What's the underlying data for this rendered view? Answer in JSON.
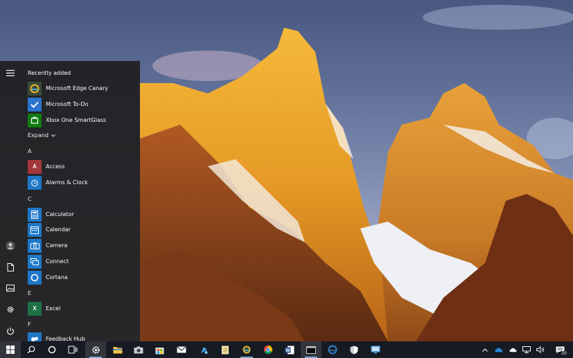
{
  "start_menu": {
    "recently_added_label": "Recently added",
    "expand_label": "Expand",
    "recent": [
      {
        "label": "Microsoft Edge Canary",
        "icon": "edge-canary-icon",
        "color": "#3a4a38"
      },
      {
        "label": "Microsoft To-Do",
        "icon": "todo-icon",
        "color": "#2a73cf"
      },
      {
        "label": "Xbox One SmartGlass",
        "icon": "xbox-icon",
        "color": "#107c10"
      }
    ],
    "letters": {
      "a": "A",
      "c": "C",
      "e": "E",
      "f": "F"
    },
    "apps_a": [
      {
        "label": "Access",
        "icon": "access-icon",
        "color": "#a4373a"
      },
      {
        "label": "Alarms & Clock",
        "icon": "alarm-clock-icon",
        "color": "#1e78c8"
      }
    ],
    "apps_c": [
      {
        "label": "Calculator",
        "icon": "calculator-icon",
        "color": "#1e78c8"
      },
      {
        "label": "Calendar",
        "icon": "calendar-icon",
        "color": "#1e78c8"
      },
      {
        "label": "Camera",
        "icon": "camera-icon",
        "color": "#1e78c8"
      },
      {
        "label": "Connect",
        "icon": "connect-icon",
        "color": "#1e78c8"
      },
      {
        "label": "Cortana",
        "icon": "cortana-icon",
        "color": "#1e78c8"
      }
    ],
    "apps_e": [
      {
        "label": "Excel",
        "icon": "excel-icon",
        "color": "#1e7145"
      }
    ],
    "apps_f": [
      {
        "label": "Feedback Hub",
        "icon": "feedback-hub-icon",
        "color": "#1e78c8"
      }
    ]
  },
  "taskbar": {
    "notification_count": "20"
  }
}
